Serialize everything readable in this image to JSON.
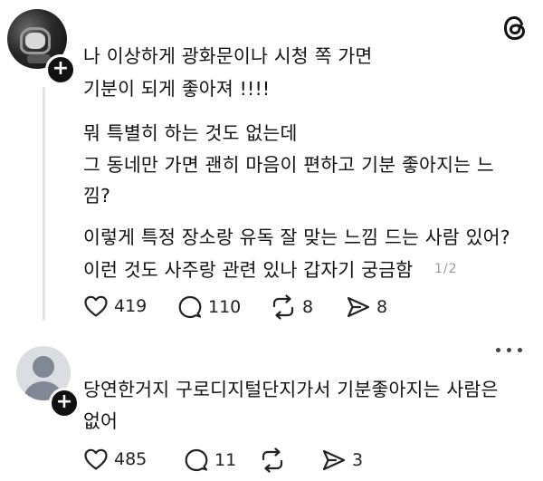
{
  "post": {
    "lines": [
      "나 이상하게 광화문이나 시청 쪽 가면",
      "기분이 되게 좋아져 !!!!",
      "뭐 특별히 하는 것도 없는데",
      "그 동네만 가면 괜히 마음이 편하고 기분 좋아지는 느",
      "낌?",
      "이렇게 특정 장소랑 유독 잘 맞는 느낌 드는 사람 있어?",
      "이런 것도 사주랑 관련 있나 갑자기 궁금함"
    ],
    "page_indicator": "1/2",
    "likes": "419",
    "comments": "110",
    "reposts": "8",
    "shares": "8"
  },
  "reply": {
    "lines": [
      "당연한거지 구로디지털단지가서 기분좋아지는 사람은",
      "없어"
    ],
    "likes": "485",
    "comments": "11",
    "reposts": "",
    "shares": "3"
  },
  "icons": {
    "logo": "threads-logo-icon",
    "follow": "plus-icon",
    "like": "heart-icon",
    "comment": "speech-bubble-icon",
    "repost": "repost-icon",
    "share": "send-icon",
    "more": "more-dots-icon"
  }
}
